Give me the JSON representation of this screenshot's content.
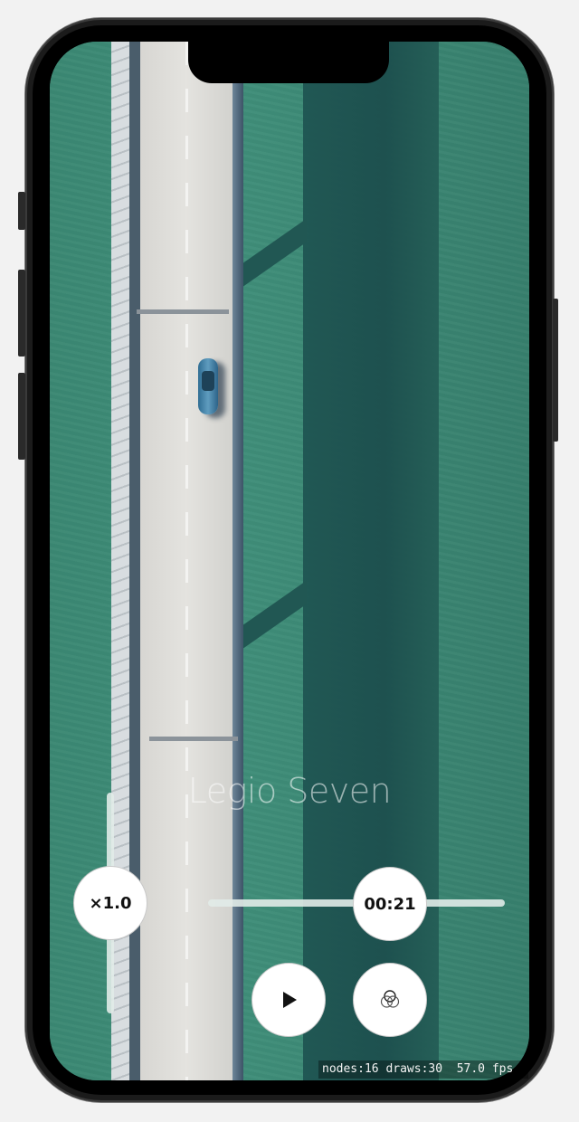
{
  "video": {
    "title": "Legio Seven",
    "current_time": "00:21",
    "progress": 0.6
  },
  "controls": {
    "speed_label": "×1.0",
    "play_icon": "play-icon",
    "effects_icon": "overlapping-circles-icon"
  },
  "debug": {
    "stats": "nodes:16 draws:30  57.0 fps"
  },
  "colors": {
    "water": "#3d8a76",
    "bridge_shadow": "#1f5552",
    "button_background": "#ffffff",
    "track": "#e1ebe8"
  }
}
